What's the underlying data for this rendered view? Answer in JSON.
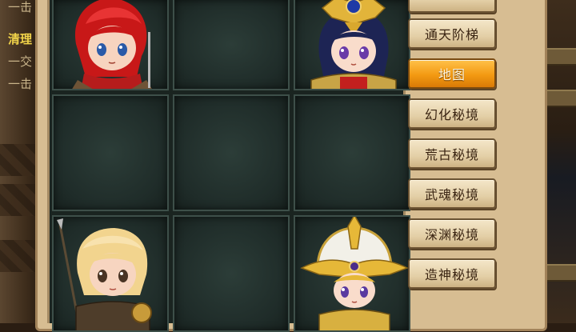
{
  "quest_panel": {
    "line1": "一击",
    "title": "清理",
    "line2": "一交",
    "line3": "一击"
  },
  "side_menu": {
    "items": [
      {
        "label": "",
        "active": false
      },
      {
        "label": "通天阶梯",
        "active": false
      },
      {
        "label": "地图",
        "active": true
      },
      {
        "label": "幻化秘境",
        "active": false
      },
      {
        "label": "荒古秘境",
        "active": false
      },
      {
        "label": "武魂秘境",
        "active": false
      },
      {
        "label": "深渊秘境",
        "active": false
      },
      {
        "label": "造神秘境",
        "active": false
      }
    ]
  },
  "grid": {
    "cells": [
      {
        "character": "red-haired-warrior"
      },
      {
        "character": ""
      },
      {
        "character": "crowned-blue-haired-heroine"
      },
      {
        "character": ""
      },
      {
        "character": ""
      },
      {
        "character": ""
      },
      {
        "character": "blonde-spear-warrior"
      },
      {
        "character": ""
      },
      {
        "character": "golden-helmet-knight"
      }
    ]
  },
  "colors": {
    "active_button": "#f39a12",
    "button": "#ecdcb9",
    "frame": "#d7bd92",
    "cell": "#23322e"
  }
}
